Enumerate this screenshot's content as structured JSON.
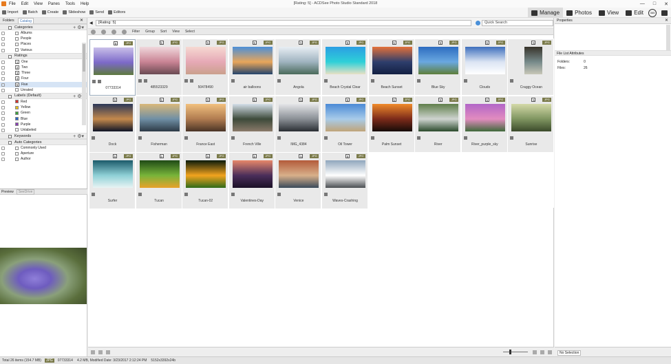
{
  "app": {
    "title": "[Rating: 5] - ACDSee Photo Studio Standard 2018",
    "menu": [
      "File",
      "Edit",
      "View",
      "Panes",
      "Tools",
      "Help"
    ]
  },
  "toolbar": {
    "items": [
      "Import",
      "Batch",
      "Create",
      "Slideshow",
      "Send",
      "Editors"
    ]
  },
  "modes": {
    "items": [
      "Manage",
      "Photos",
      "View",
      "Edit"
    ],
    "active": "Manage",
    "round_label": "365"
  },
  "left_tabs": {
    "items": [
      "Folders",
      "Catalog"
    ],
    "selected": "Catalog"
  },
  "catalog": {
    "categories_title": "Categories",
    "categories": [
      "Albums",
      "People",
      "Places",
      "Various"
    ],
    "ratings_title": "Ratings",
    "ratings": [
      {
        "num": "1",
        "label": "One"
      },
      {
        "num": "2",
        "label": "Two"
      },
      {
        "num": "3",
        "label": "Three"
      },
      {
        "num": "4",
        "label": "Four"
      },
      {
        "num": "5",
        "label": "Five"
      }
    ],
    "unrated_label": "Unrated",
    "labels_title": "Labels (Default)",
    "labels": [
      {
        "label": "Red",
        "color": "#d8302b"
      },
      {
        "label": "Yellow",
        "color": "#e9c21b"
      },
      {
        "label": "Green",
        "color": "#3ba23b"
      },
      {
        "label": "Blue",
        "color": "#2b66c8"
      },
      {
        "label": "Purple",
        "color": "#8a3fb5"
      },
      {
        "label": "Unlabeled",
        "color": "#ffffff"
      }
    ],
    "keywords_title": "Keywords",
    "auto_title": "Auto Categories",
    "auto_items": [
      "Commonly Used",
      "Aperture",
      "Author"
    ]
  },
  "preview_tabs": {
    "items": [
      "Preview",
      "SeeDrive"
    ]
  },
  "path": {
    "value": "[Rating: 5]",
    "quick_search": "Quick Search"
  },
  "filters": [
    "Filter",
    "Group",
    "Sort",
    "View",
    "Select"
  ],
  "images": [
    {
      "name": "07733314",
      "rating": "5",
      "fmt": "JPG",
      "colors": [
        "#c9c0e9",
        "#7c69c9",
        "#5e7a3e"
      ],
      "orient": "land"
    },
    {
      "name": "485523329",
      "rating": "5",
      "fmt": "JPG",
      "colors": [
        "#f0d8dc",
        "#c98394",
        "#6a4a52"
      ],
      "orient": "land"
    },
    {
      "name": "50478490",
      "rating": "5",
      "fmt": "JPG",
      "colors": [
        "#f6d9d2",
        "#e6a9b6",
        "#caa08c"
      ],
      "orient": "land"
    },
    {
      "name": "air balloons",
      "rating": "5",
      "fmt": "JPG",
      "colors": [
        "#4c8fd8",
        "#e8a65a",
        "#22436b"
      ],
      "orient": "land"
    },
    {
      "name": "Angola",
      "rating": "5",
      "fmt": "JPG",
      "colors": [
        "#e8eef4",
        "#9fb3bf",
        "#4a6a5a"
      ],
      "orient": "land"
    },
    {
      "name": "Beach Crystal Clear",
      "rating": "5",
      "fmt": "JPG",
      "colors": [
        "#2b9ee3",
        "#2ed0d8",
        "#e8e0c4"
      ],
      "orient": "land"
    },
    {
      "name": "Beach Sunset",
      "rating": "5",
      "fmt": "JPG",
      "colors": [
        "#e4713a",
        "#2e3e6c",
        "#132042"
      ],
      "orient": "land"
    },
    {
      "name": "Blue Sky",
      "rating": "5",
      "fmt": "JPG",
      "colors": [
        "#2d6cc0",
        "#6aa8e0",
        "#5e7e3a"
      ],
      "orient": "land"
    },
    {
      "name": "Clouds",
      "rating": "5",
      "fmt": "JPG",
      "colors": [
        "#3e6fbd",
        "#dbe4f3",
        "#ffffff"
      ],
      "orient": "land"
    },
    {
      "name": "Craggy Ocean",
      "rating": "5",
      "fmt": "JPG",
      "colors": [
        "#38332a",
        "#768a8a",
        "#c8c7b8"
      ],
      "orient": "port"
    },
    {
      "name": "Dock",
      "rating": "5",
      "fmt": "JPG",
      "colors": [
        "#2b3757",
        "#c4894c",
        "#0f1426"
      ],
      "orient": "land"
    },
    {
      "name": "Fisherman",
      "rating": "5",
      "fmt": "JPG",
      "colors": [
        "#d9b87a",
        "#6f8fa5",
        "#2d3a46"
      ],
      "orient": "land"
    },
    {
      "name": "France East",
      "rating": "5",
      "fmt": "JPG",
      "colors": [
        "#f1c07d",
        "#b07b50",
        "#4a3426"
      ],
      "orient": "land"
    },
    {
      "name": "French Ville",
      "rating": "5",
      "fmt": "JPG",
      "colors": [
        "#d4dfe9",
        "#3d4a3a",
        "#8a7a6a"
      ],
      "orient": "land"
    },
    {
      "name": "IMG_4384",
      "rating": "5",
      "fmt": "JPG",
      "colors": [
        "#e4e5e8",
        "#8a8f95",
        "#2a2e33"
      ],
      "orient": "land"
    },
    {
      "name": "Oil Tower",
      "rating": "5",
      "fmt": "JPG",
      "colors": [
        "#4a8ad6",
        "#a8cbe9",
        "#c0a478"
      ],
      "orient": "land"
    },
    {
      "name": "Palm Sunset",
      "rating": "5",
      "fmt": "JPG",
      "colors": [
        "#f08a2a",
        "#7b2a1a",
        "#150b08"
      ],
      "orient": "land"
    },
    {
      "name": "River",
      "rating": "5",
      "fmt": "JPG",
      "colors": [
        "#5f7f4b",
        "#cfd4d0",
        "#2b4a2c"
      ],
      "orient": "land"
    },
    {
      "name": "River_purple_sky",
      "rating": "5",
      "fmt": "JPG",
      "colors": [
        "#b266c8",
        "#e28cbf",
        "#3f6a3a"
      ],
      "orient": "land"
    },
    {
      "name": "Sunrise",
      "rating": "5",
      "fmt": "JPG",
      "colors": [
        "#d4d9a8",
        "#7f9560",
        "#3b4a2a"
      ],
      "orient": "land"
    },
    {
      "name": "Surfer",
      "rating": "5",
      "fmt": "JPG",
      "colors": [
        "#1b5a6a",
        "#8fd0d6",
        "#e8f4f4"
      ],
      "orient": "land"
    },
    {
      "name": "Tucan",
      "rating": "5",
      "fmt": "JPG",
      "colors": [
        "#1f4a16",
        "#78b43a",
        "#e8a22a"
      ],
      "orient": "land"
    },
    {
      "name": "Tucan-02",
      "rating": "5",
      "fmt": "JPG",
      "colors": [
        "#0a1a0a",
        "#f2a31e",
        "#2e6a1a"
      ],
      "orient": "land"
    },
    {
      "name": "Valentines-Day",
      "rating": "5",
      "fmt": "JPG",
      "colors": [
        "#e7876a",
        "#4a2e5a",
        "#1a1026"
      ],
      "orient": "land"
    },
    {
      "name": "Venice",
      "rating": "5",
      "fmt": "JPG",
      "colors": [
        "#b35a3a",
        "#d8b08a",
        "#3a4a5a"
      ],
      "orient": "land"
    },
    {
      "name": "Waves-Crashing",
      "rating": "5",
      "fmt": "JPG",
      "colors": [
        "#8fa6bd",
        "#ffffff",
        "#4a4e52"
      ],
      "orient": "land"
    }
  ],
  "properties": {
    "title": "Properties",
    "section": "File List Attributes",
    "folders_label": "Folders:",
    "folders_value": "0",
    "files_label": "Files:",
    "files_value": "26",
    "no_selection": "No Selection"
  },
  "status": {
    "total": "Total 26 items  (154.7 MB)",
    "fmt": "JPG",
    "file": "07733314",
    "details": "4.2 MB, Modified Date: 3/23/2017 2:12:24 PM",
    "dims": "5152x3392x24b"
  }
}
